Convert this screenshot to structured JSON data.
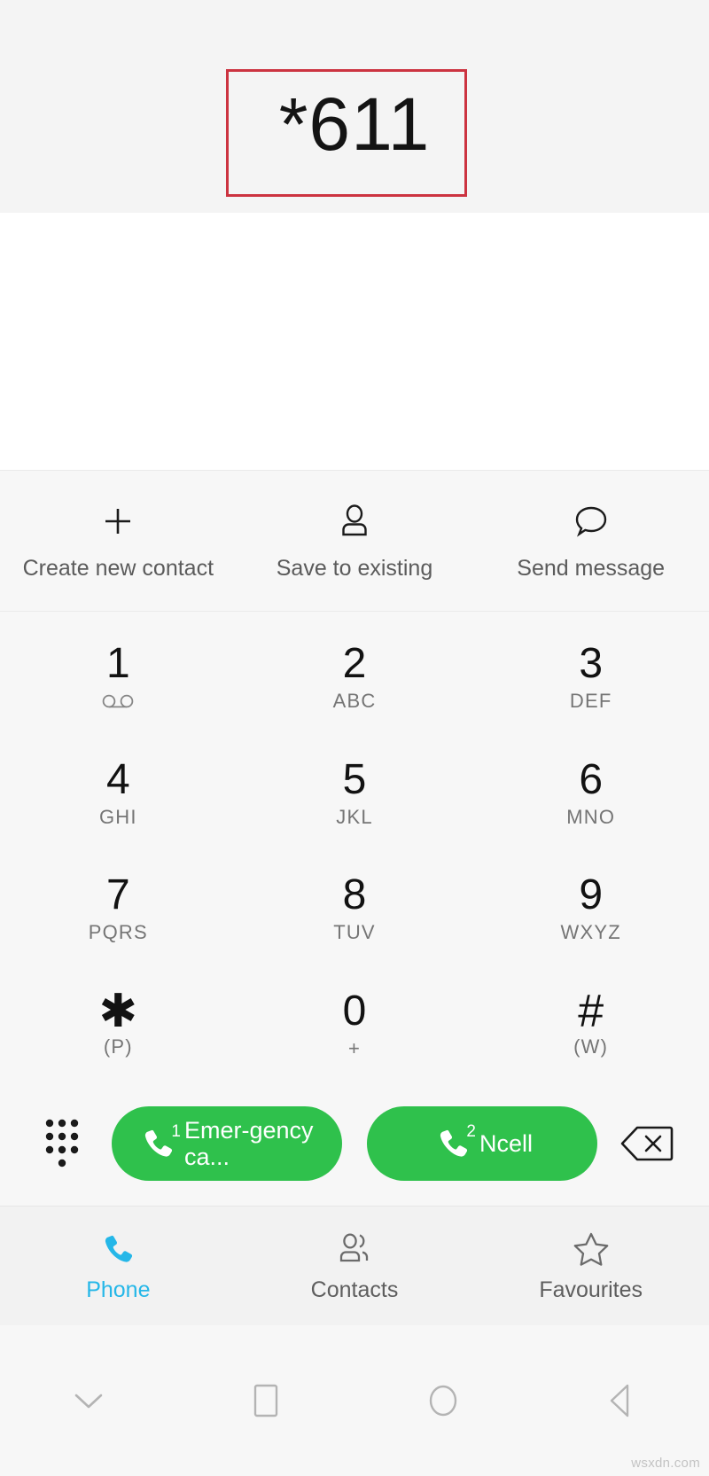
{
  "display": {
    "dialed_number": "*611"
  },
  "annotation": {
    "color": "#cc3340"
  },
  "actions": [
    {
      "label": "Create new contact",
      "icon": "plus-icon"
    },
    {
      "label": "Save to existing",
      "icon": "person-icon"
    },
    {
      "label": "Send message",
      "icon": "message-bubble-icon"
    }
  ],
  "keypad": [
    [
      {
        "digit": "1",
        "sub": "",
        "icon": "voicemail-icon"
      },
      {
        "digit": "2",
        "sub": "ABC",
        "icon": ""
      },
      {
        "digit": "3",
        "sub": "DEF",
        "icon": ""
      }
    ],
    [
      {
        "digit": "4",
        "sub": "GHI",
        "icon": ""
      },
      {
        "digit": "5",
        "sub": "JKL",
        "icon": ""
      },
      {
        "digit": "6",
        "sub": "MNO",
        "icon": ""
      }
    ],
    [
      {
        "digit": "7",
        "sub": "PQRS",
        "icon": ""
      },
      {
        "digit": "8",
        "sub": "TUV",
        "icon": ""
      },
      {
        "digit": "9",
        "sub": "WXYZ",
        "icon": ""
      }
    ],
    [
      {
        "digit": "✱",
        "sub": "(P)",
        "icon": ""
      },
      {
        "digit": "0",
        "sub": "+",
        "icon": ""
      },
      {
        "digit": "#",
        "sub": "(W)",
        "icon": ""
      }
    ]
  ],
  "call_row": {
    "dialpad_toggle_icon": "dialpad-dots-icon",
    "backspace_icon": "backspace-icon",
    "buttons": [
      {
        "sim": "1",
        "label": "Emer-gency ca...",
        "color": "#2fc14c"
      },
      {
        "sim": "2",
        "label": "Ncell",
        "color": "#2fc14c"
      }
    ]
  },
  "tabs": [
    {
      "label": "Phone",
      "icon": "phone-icon",
      "active": true
    },
    {
      "label": "Contacts",
      "icon": "contacts-icon",
      "active": false
    },
    {
      "label": "Favourites",
      "icon": "star-icon",
      "active": false
    }
  ],
  "nav_bar": [
    {
      "icon": "chevron-down-icon"
    },
    {
      "icon": "square-recents-icon"
    },
    {
      "icon": "circle-home-icon"
    },
    {
      "icon": "triangle-back-icon"
    }
  ],
  "watermark": {
    "text": "wsxdn.com"
  },
  "colors": {
    "call_green": "#2fc14c",
    "active_tab": "#25b7e8",
    "annotation_red": "#cc3340"
  }
}
